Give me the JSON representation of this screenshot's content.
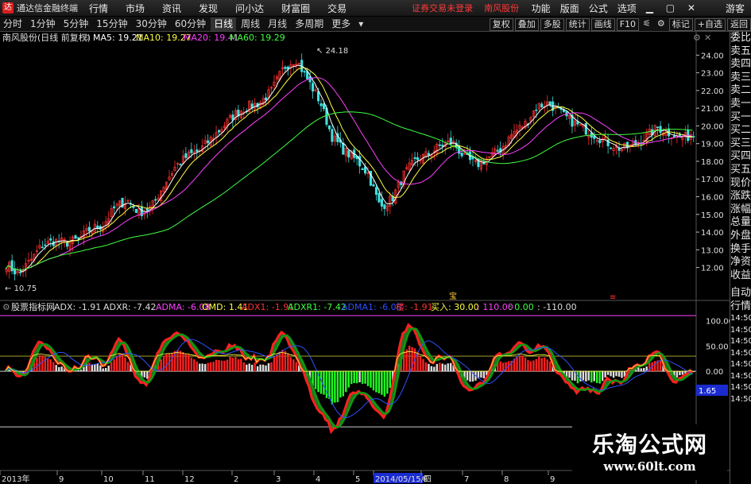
{
  "titlebar": {
    "app_title": "通达信金融终端",
    "menus": [
      "行情",
      "市场",
      "资讯",
      "发现",
      "问小达",
      "财富圈",
      "交易"
    ],
    "warning": "证券交易未登录",
    "stock_name": "南风股份",
    "right_items": [
      "功能",
      "版面",
      "公式",
      "选项"
    ],
    "guest": "游客"
  },
  "toolbar": {
    "periods": [
      "分时",
      "1分钟",
      "5分钟",
      "15分钟",
      "30分钟",
      "60分钟",
      "日线",
      "周线",
      "月线",
      "多周期",
      "更多"
    ],
    "active_period": "日线",
    "tools": [
      "复权",
      "叠加",
      "多股",
      "统计",
      "画线",
      "F10",
      "标记",
      "+自选",
      "返回"
    ]
  },
  "main_legend": {
    "title": "南风股份(日线 前复权)",
    "ma": [
      {
        "label": "MA5: 19.21",
        "color": "#ffffff"
      },
      {
        "label": "MA10: 19.27",
        "color": "#ffff40"
      },
      {
        "label": "MA20: 19.41",
        "color": "#ff40ff"
      },
      {
        "label": "MA60: 19.29",
        "color": "#40ff40"
      }
    ]
  },
  "price_axis": [
    "24.00",
    "23.00",
    "22.00",
    "21.00",
    "20.00",
    "19.00",
    "18.00",
    "17.00",
    "16.00",
    "15.00",
    "14.00",
    "13.00",
    "12.00"
  ],
  "high_label": "24.18",
  "low_label": "10.75",
  "event_marker": "宝",
  "indicator_legend": {
    "title": "股票指标网",
    "items": [
      {
        "label": "ADX: -1.91",
        "color": "#dddddd"
      },
      {
        "label": "ADXR: -7.42",
        "color": "#dddddd"
      },
      {
        "label": "ADMA: -6.08",
        "color": "#ff40ff"
      },
      {
        "label": "OMD: 1.41",
        "color": "#ffff40"
      },
      {
        "label": "ADX1: -1.91",
        "color": "#ff3030"
      },
      {
        "label": "ADXR1: -7.42",
        "color": "#40ff40"
      },
      {
        "label": "ADMA1: -6.08",
        "color": "#3050ff"
      },
      {
        "label": "楼: -1.91",
        "color": "#ff3030"
      },
      {
        "label": "买入: 30.00",
        "color": "#ffff40"
      },
      {
        "label": ": 110.00",
        "color": "#ff40ff"
      },
      {
        "label": ": 0.00",
        "color": "#40ff40"
      },
      {
        "label": ": -110.00",
        "color": "#dddddd"
      }
    ]
  },
  "indicator_axis": [
    "100.00",
    "50.00",
    "0.00"
  ],
  "indicator_value_box": "1.65",
  "date_axis": [
    "2013年",
    "9",
    "10",
    "11",
    "12",
    "2",
    "3",
    "4",
    "5",
    "2014/05/15/四",
    "6",
    "7",
    "8",
    "9"
  ],
  "sidebar": {
    "top": [
      "委比",
      "卖五",
      "卖四",
      "卖三",
      "卖二",
      "卖一",
      "买一",
      "买二",
      "买三",
      "买四",
      "买五",
      "现价",
      "涨跌",
      "涨幅",
      "总量",
      "外盘",
      "换手",
      "净资",
      "收益"
    ],
    "bottom": [
      "自动",
      "行情"
    ],
    "times": [
      "14:50",
      "14:50",
      "14:50",
      "14:50",
      "14:50",
      "14:50",
      "14:50",
      "14:50"
    ]
  },
  "watermark": {
    "cn": "乐淘公式网",
    "url": "www.60lt.com"
  },
  "colors": {
    "up": "#ff3030",
    "down": "#40e0e0",
    "ma5": "#ffffff",
    "ma10": "#ffff40",
    "ma20": "#ff40ff",
    "ma60": "#40ff40"
  },
  "chart_data": {
    "type": "candlestick",
    "close_series": [
      12.2,
      11.6,
      12.4,
      13.3,
      13.5,
      13.4,
      13.6,
      14.2,
      14.4,
      15.4,
      15.8,
      15.1,
      15.4,
      16.6,
      17.7,
      18.3,
      18.6,
      19.3,
      20.0,
      20.7,
      21.1,
      21.3,
      22.0,
      23.3,
      23.8,
      22.6,
      21.4,
      19.4,
      18.6,
      18.1,
      17.3,
      15.4,
      15.9,
      17.3,
      18.1,
      18.4,
      18.9,
      19.1,
      18.2,
      17.8,
      18.2,
      18.7,
      19.6,
      20.1,
      21.1,
      21.3,
      20.7,
      20.2,
      19.8,
      19.4,
      19.0,
      18.7,
      18.9,
      19.4,
      19.9,
      19.6,
      19.3,
      19.5
    ],
    "y_range": [
      10.5,
      24.6
    ],
    "indicator_range": [
      -190,
      115
    ]
  }
}
